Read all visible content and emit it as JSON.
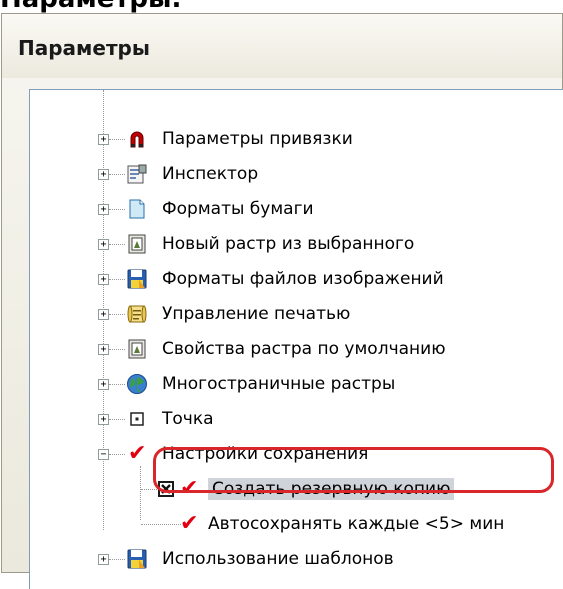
{
  "page_heading": "Параметры.",
  "dialog": {
    "title": "Параметры"
  },
  "tree": {
    "items": [
      {
        "label": "Параметры привязки",
        "icon": "magnet-icon"
      },
      {
        "label": "Инспектор",
        "icon": "inspector-icon"
      },
      {
        "label": "Форматы бумаги",
        "icon": "paper-icon"
      },
      {
        "label": "Новый растр из выбранного",
        "icon": "raster-icon"
      },
      {
        "label": "Форматы файлов изображений",
        "icon": "floppy-icon"
      },
      {
        "label": "Управление печатью",
        "icon": "scroll-icon"
      },
      {
        "label": "Свойства растра по умолчанию",
        "icon": "raster-icon"
      },
      {
        "label": "Многостраничные растры",
        "icon": "globe-icon"
      },
      {
        "label": "Точка",
        "icon": "point-icon"
      },
      {
        "label": "Настройки сохранения",
        "icon": "check-icon"
      },
      {
        "label": "Создать резервную копию",
        "icon": "check-icon"
      },
      {
        "label": "Автосохранять каждые <5> мин",
        "icon": "check-icon"
      },
      {
        "label": "Использование шаблонов",
        "icon": "floppy-icon"
      }
    ]
  },
  "colors": {
    "accent_red": "#d8262a",
    "check_red": "#e00010",
    "selection": "#cfd4da"
  }
}
